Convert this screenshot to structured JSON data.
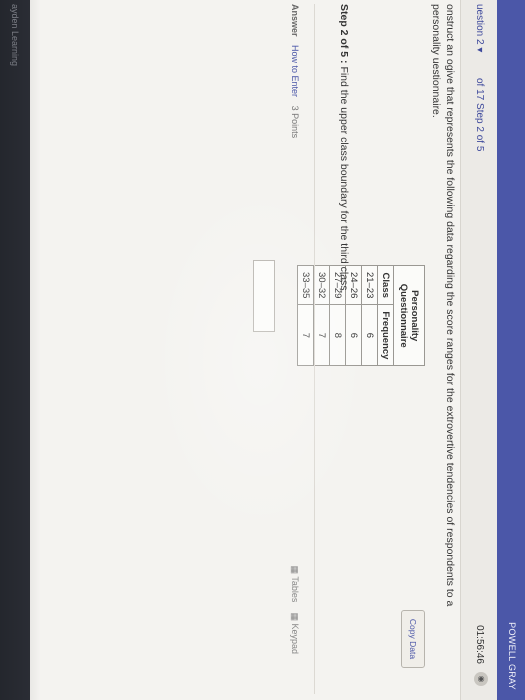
{
  "topbar": {
    "user_name": "POWELL GRAY"
  },
  "nav": {
    "question_dropdown": "uestion 2",
    "question_progress": "of 17 Step 2 of 5",
    "timer": "01:56:46"
  },
  "prompt": {
    "text": "onstruct an ogive that represents the following data regarding the score ranges for the extrovertive tendencies of respondents to a personality uestionnaire."
  },
  "table": {
    "caption_line1": "Personality",
    "caption_line2": "Questionnaire",
    "headers": [
      "Class",
      "Frequency"
    ],
    "rows": [
      [
        "21–23",
        "6"
      ],
      [
        "24–26",
        "6"
      ],
      [
        "27–29",
        "8"
      ],
      [
        "30–32",
        "7"
      ],
      [
        "33–35",
        "7"
      ]
    ]
  },
  "copy_data_label": "Copy Data",
  "step": {
    "label": "Step 2 of 5 :",
    "text": "Find the upper class boundary for the third class."
  },
  "answer": {
    "label": "Answer",
    "how_to_enter": "How to Enter",
    "points": "3 Points",
    "tables_label": "Tables",
    "keypad_label": "Keypad"
  },
  "footer": {
    "brand": "ayden Learning"
  }
}
